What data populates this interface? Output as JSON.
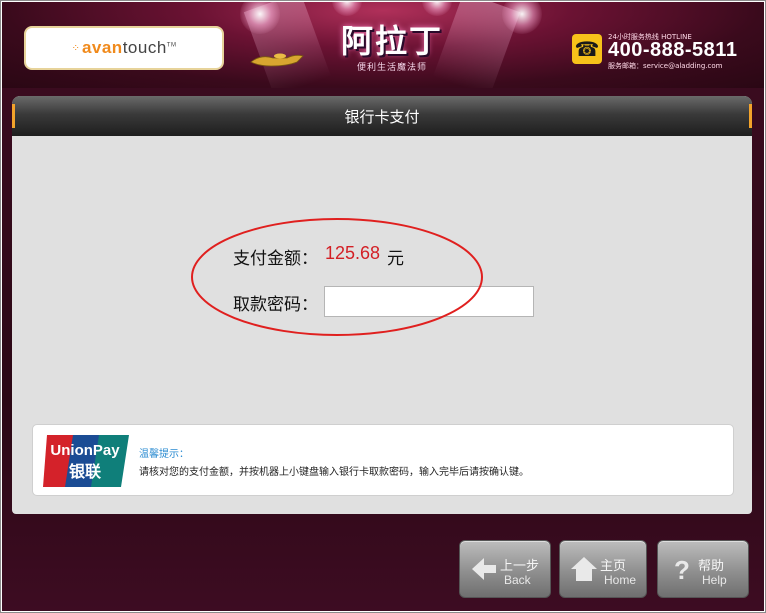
{
  "header": {
    "logo_text_prefix": "avan",
    "logo_text_suffix": "touch",
    "logo_tm": "TM",
    "brand_name": "阿拉丁",
    "brand_tagline": "便利生活魔法师",
    "hotline_label": "24小时服务热线 HOTLINE",
    "hotline_number": "400-888-5811",
    "service_email": "服务邮箱：service@aladding.com"
  },
  "panel": {
    "title": "银行卡支付"
  },
  "payment": {
    "amount_label": "支付金额：",
    "amount_value": "125.68",
    "amount_unit": "元",
    "password_label": "取款密码：",
    "password_value": ""
  },
  "notice": {
    "card_logo_top": "UnionPay",
    "card_logo_bottom": "银联",
    "title": "温馨提示：",
    "text": "请核对您的支付金额，并按机器上小键盘输入银行卡取款密码，输入完毕后请按确认键。"
  },
  "nav": {
    "back_zh": "上一步",
    "back_en": "Back",
    "home_zh": "主页",
    "home_en": "Home",
    "help_zh": "帮助",
    "help_en": "Help"
  },
  "colors": {
    "amount_red": "#d31f25",
    "header_bg": "#3a0a1c",
    "accent_orange": "#f3a32b",
    "tip_blue": "#2a8bd1"
  }
}
